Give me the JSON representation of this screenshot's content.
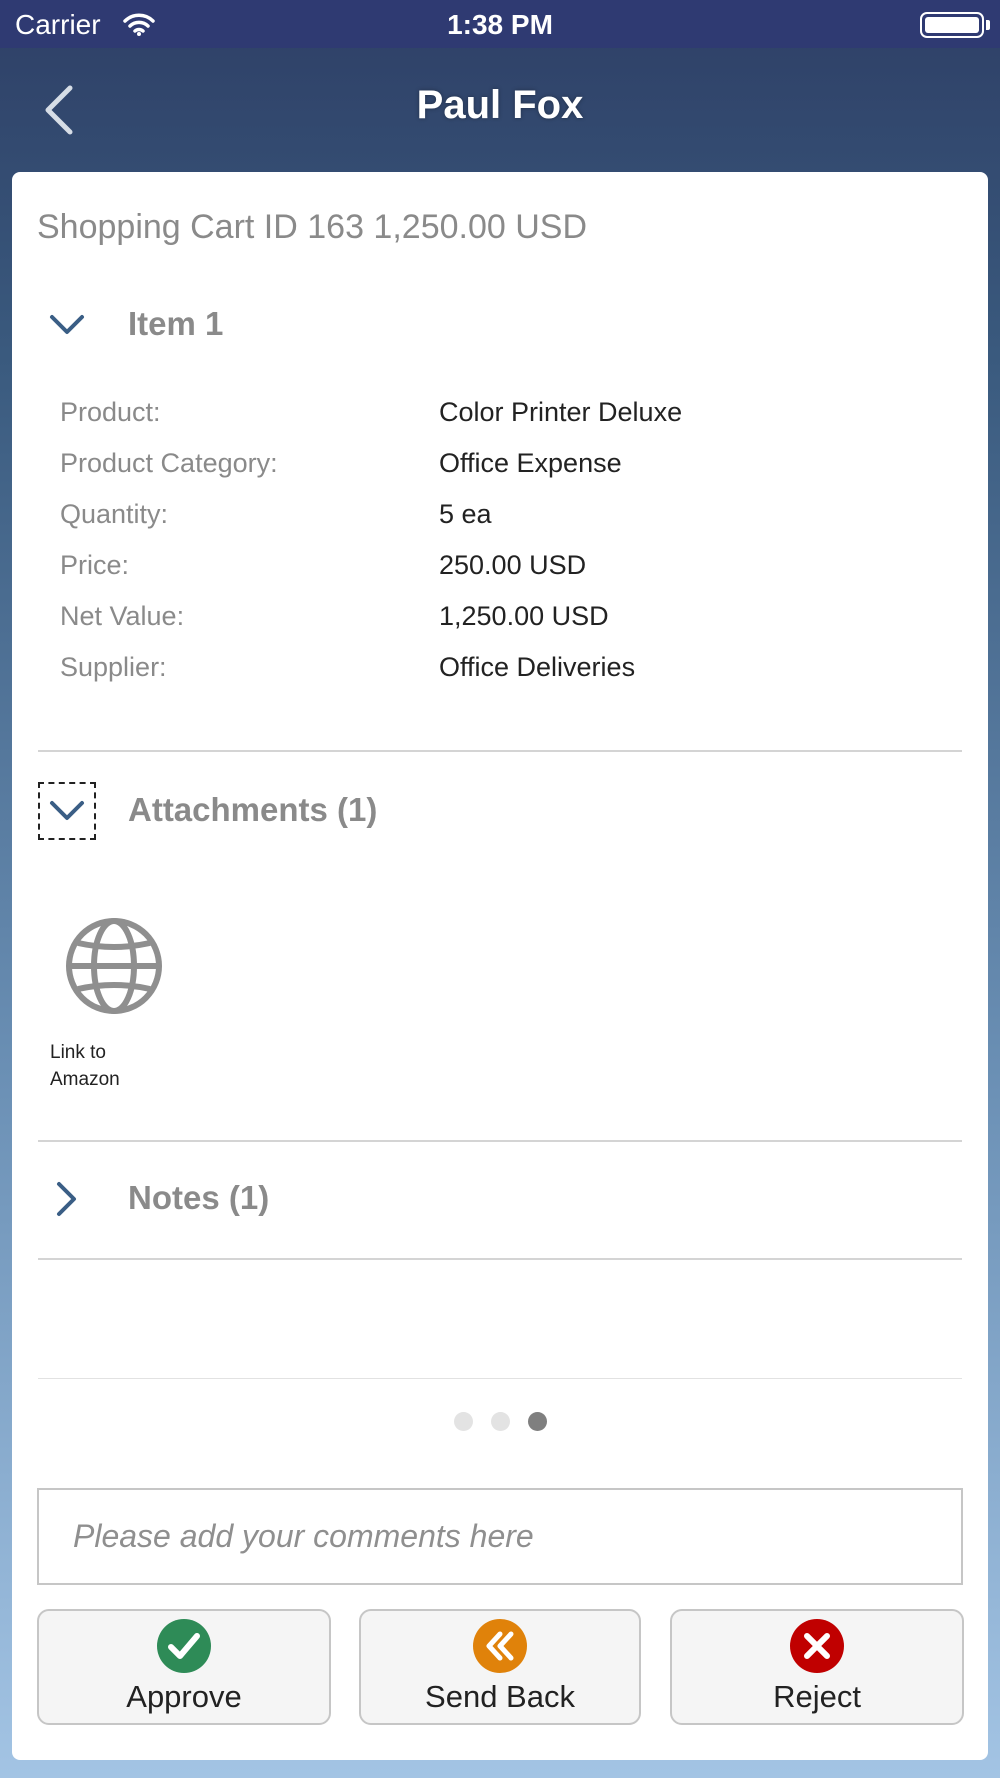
{
  "status_bar": {
    "carrier": "Carrier",
    "time": "1:38 PM"
  },
  "nav": {
    "title": "Paul Fox"
  },
  "cart": {
    "title": "Shopping Cart ID 163 1,250.00 USD",
    "item_section": {
      "label": "Item 1",
      "properties": [
        {
          "key": "Product:",
          "value": "Color Printer Deluxe"
        },
        {
          "key": "Product Category:",
          "value": "Office Expense"
        },
        {
          "key": "Quantity:",
          "value": "5 ea"
        },
        {
          "key": "Price:",
          "value": "250.00 USD"
        },
        {
          "key": "Net Value:",
          "value": "1,250.00 USD"
        },
        {
          "key": "Supplier:",
          "value": "Office Deliveries"
        }
      ]
    },
    "attachments_section": {
      "label": "Attachments (1)",
      "items": [
        {
          "label_line1": "Link to",
          "label_line2": "Amazon",
          "icon": "globe-icon"
        }
      ]
    },
    "notes_section": {
      "label": "Notes (1)"
    }
  },
  "pager": {
    "count": 3,
    "active_index": 2
  },
  "comment": {
    "placeholder": "Please add your comments here",
    "value": ""
  },
  "actions": {
    "approve": {
      "label": "Approve",
      "color": "#2e8b57"
    },
    "send_back": {
      "label": "Send Back",
      "color": "#e0820a"
    },
    "reject": {
      "label": "Reject",
      "color": "#c00000"
    }
  },
  "colors": {
    "accent": "#3a5e85",
    "muted_text": "#8a8a8a"
  }
}
